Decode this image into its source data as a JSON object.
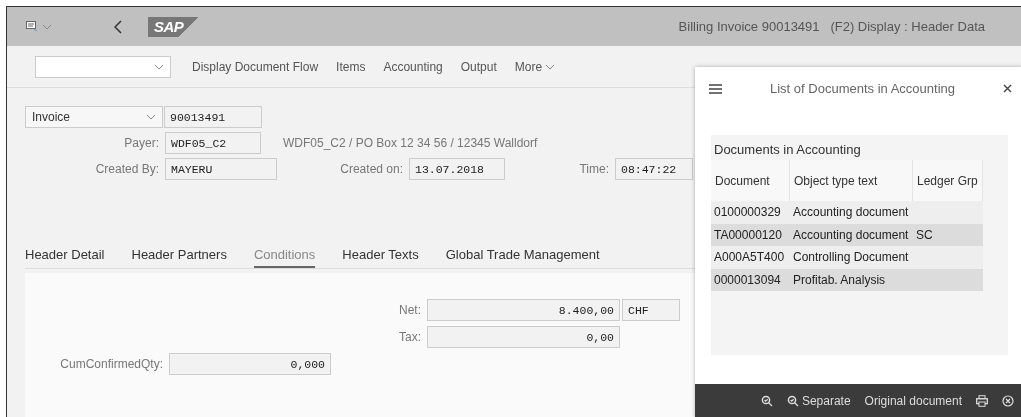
{
  "header": {
    "title": "Billing Invoice 90013491   (F2) Display : Header Data",
    "logo": "SAP"
  },
  "toolbar": {
    "buttons": [
      "Display Document Flow",
      "Items",
      "Accounting",
      "Output"
    ],
    "more": "More"
  },
  "document": {
    "type": "Invoice",
    "number": "90013491"
  },
  "fields": {
    "payer_label": "Payer:",
    "payer": "WDF05_C2",
    "payer_address": "WDF05_C2 / PO Box 12 34 56 / 12345 Walldorf",
    "created_by_label": "Created By:",
    "created_by": "MAYERU",
    "created_on_label": "Created on:",
    "created_on": "13.07.2018",
    "time_label": "Time:",
    "time": "08:47:22"
  },
  "tabs": [
    {
      "label": "Header Detail",
      "selected": false
    },
    {
      "label": "Header Partners",
      "selected": false
    },
    {
      "label": "Conditions",
      "selected": true
    },
    {
      "label": "Header Texts",
      "selected": false
    },
    {
      "label": "Global Trade Management",
      "selected": false
    }
  ],
  "conditions": {
    "net_label": "Net:",
    "net": "8.400,00",
    "currency": "CHF",
    "tax_label": "Tax:",
    "tax": "0,00",
    "qty_label": "CumConfirmedQty:",
    "qty": "0,000"
  },
  "side_panel": {
    "title": "List of Documents in Accounting",
    "table_title": "Documents in Accounting",
    "columns": [
      "Document",
      "Object type text",
      "Ledger Grp"
    ],
    "rows": [
      [
        "0100000329",
        "Accounting document",
        ""
      ],
      [
        "TA00000120",
        "Accounting document",
        "SC"
      ],
      [
        "A000A5T400",
        "Controlling Document",
        ""
      ],
      [
        "0000013094",
        "Profitab. Analysis",
        ""
      ]
    ],
    "footer": {
      "separate": "Separate",
      "original": "Original document"
    }
  }
}
